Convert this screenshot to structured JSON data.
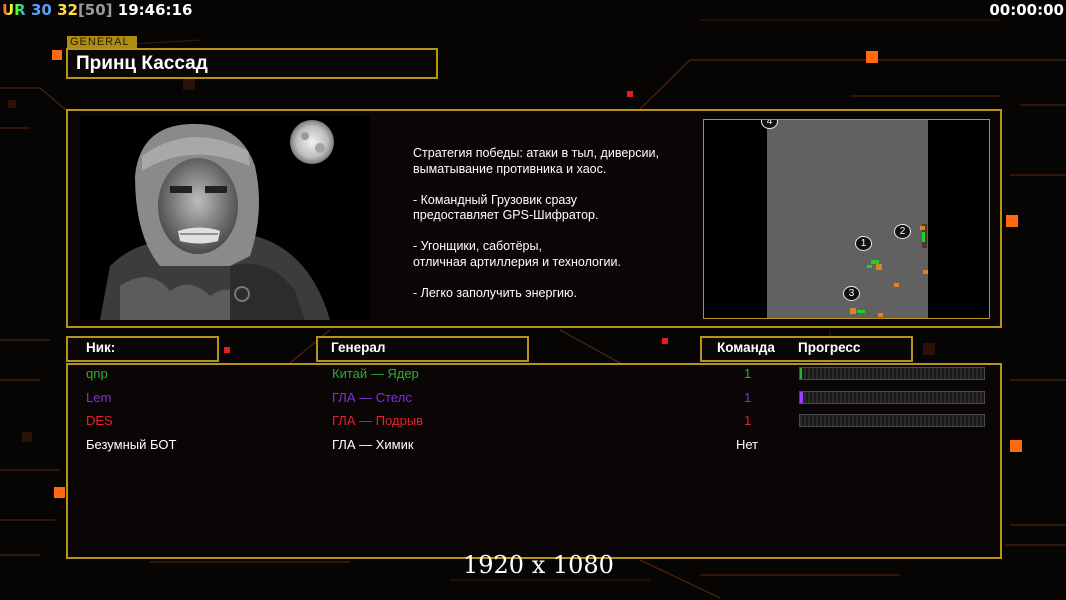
{
  "hud": {
    "ur": "UR",
    "fps": "30",
    "limit_value": "32",
    "limit_bracket": "[50]",
    "clock": "19:46:16",
    "timer": "00:00:00"
  },
  "general": {
    "tag": "GENERAL",
    "name": "Принц Кассад"
  },
  "description": "Стратегия победы: атаки в тыл, диверсии,\n выматывание противника и хаос.\n\n- Командный Грузовик сразу\nпредоставляет GPS-Шифратор.\n\n- Угонщики, саботёры,\nотличная артиллерия и технологии.\n\n- Легко заполучить энергию.",
  "map": {
    "start_positions": [
      "1",
      "2",
      "3",
      "4"
    ]
  },
  "table": {
    "headers": {
      "nick": "Ник:",
      "general": "Генерал",
      "team": "Команда",
      "progress": "Прогресс"
    },
    "rows": [
      {
        "nick": "qnp",
        "general": "Китай — Ядер",
        "team": "1",
        "progress": 0.01,
        "color": "#2bb02b",
        "bar_color": "#2bb02b"
      },
      {
        "nick": "Lem",
        "general": "ГЛА — Стелс",
        "team": "1",
        "progress": 0.015,
        "color": "#8b2be2",
        "bar_color": "#a040ff"
      },
      {
        "nick": "DES",
        "general": "ГЛА — Подрыв",
        "team": "1",
        "progress": 0.0,
        "color": "#e8212d",
        "bar_color": "#e8212d"
      },
      {
        "nick": "Безумный БОТ",
        "general": "ГЛА — Химик",
        "team": "Нет",
        "progress": null,
        "color": "#ffffff",
        "bar_color": ""
      }
    ]
  },
  "resolution": "1920 x 1080",
  "colors": {
    "frame": "#b59416",
    "accent_orange": "#ff6a10"
  }
}
